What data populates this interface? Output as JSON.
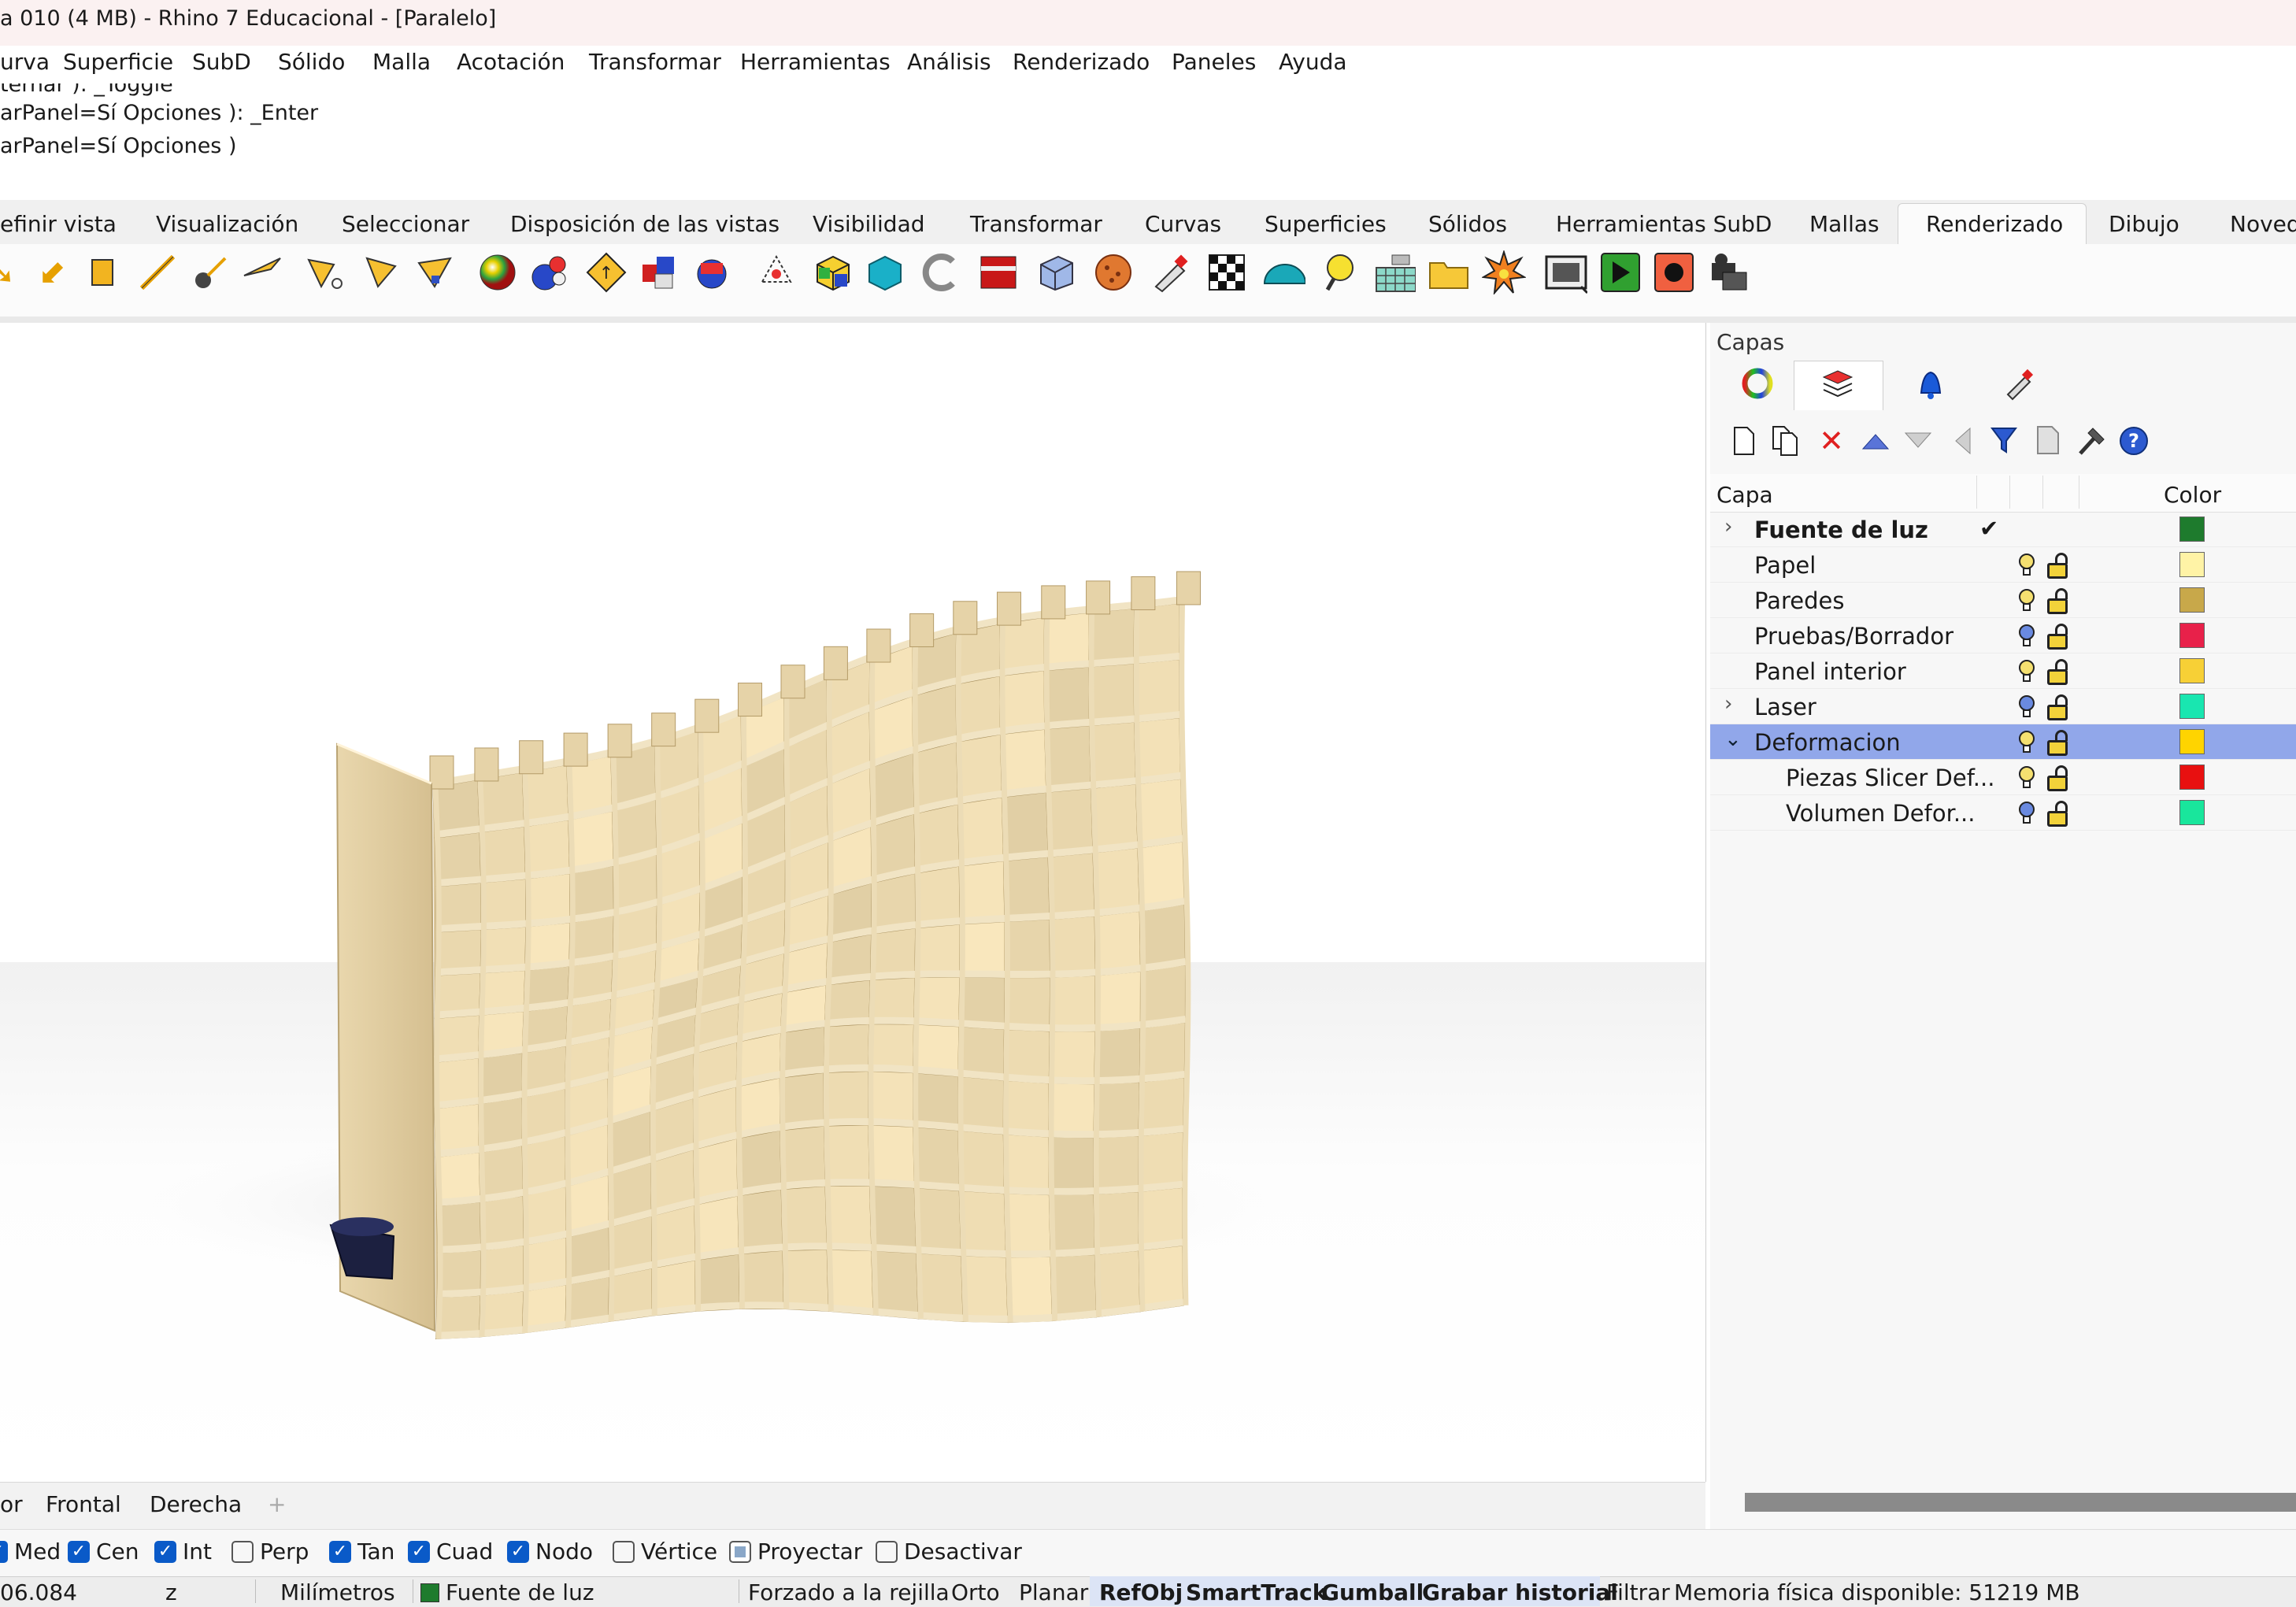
{
  "window": {
    "title": "a 010 (4 MB) - Rhino 7 Educacional - [Paralelo]"
  },
  "menu": [
    "urva",
    "Superficie",
    "SubD",
    "Sólido",
    "Malla",
    "Acotación",
    "Transformar",
    "Herramientas",
    "Análisis",
    "Renderizado",
    "Paneles",
    "Ayuda"
  ],
  "command_history": [
    "ternar ): _Toggle",
    "arPanel=Sí  Opciones ): _Enter",
    "arPanel=Sí  Opciones )"
  ],
  "toolbar_tabs": {
    "items": [
      "efinir vista",
      "Visualización",
      "Seleccionar",
      "Disposición de las vistas",
      "Visibilidad",
      "Transformar",
      "Curvas",
      "Superficies",
      "Sólidos",
      "Herramientas SubD",
      "Mallas",
      "Renderizado",
      "Dibujo",
      "Noved"
    ],
    "active": "Renderizado"
  },
  "toolbar_icons": [
    "directional-light-icon",
    "spotlight-icon",
    "rectangular-light-icon",
    "linear-light-icon",
    "point-light-icon",
    "light-icon",
    "edit-light-icon",
    "light-target-icon",
    "render-sphere-icon",
    "material-icon",
    "sun-icon",
    "decal-icon",
    "texture-map-icon",
    "environment-icon",
    "box-mapping-icon",
    "planar-mapping-icon",
    "cylindrical-mapping-icon",
    "spherical-mapping-icon",
    "uvw-mapping-icon",
    "texture-icon",
    "paint-icon",
    "checker-icon",
    "dome-icon",
    "lightbulb-icon",
    "ground-plane-icon",
    "folder-icon",
    "explode-icon",
    "render-window-icon",
    "render-icon",
    "record-icon",
    "camera-icon"
  ],
  "viewport_tabs": [
    "or",
    "Frontal",
    "Derecha",
    "+"
  ],
  "osnaps": [
    {
      "label": "Med",
      "state": "on"
    },
    {
      "label": "Cen",
      "state": "on"
    },
    {
      "label": "Int",
      "state": "on"
    },
    {
      "label": "Perp",
      "state": "off"
    },
    {
      "label": "Tan",
      "state": "on"
    },
    {
      "label": "Cuad",
      "state": "on"
    },
    {
      "label": "Nodo",
      "state": "on"
    },
    {
      "label": "Vértice",
      "state": "off"
    },
    {
      "label": "Proyectar",
      "state": "partial"
    },
    {
      "label": "Desactivar",
      "state": "off"
    }
  ],
  "status": {
    "coord": "06.084",
    "z": "z",
    "units": "Milímetros",
    "layer": "Fuente de luz",
    "layer_color": "#1e7b2d",
    "grid_snap": "Forzado a la rejilla",
    "ortho": "Orto",
    "planar": "Planar",
    "refobj": "RefObj",
    "smarttrack": "SmartTrack",
    "gumball": "Gumball",
    "history": "Grabar historial",
    "filter": "Filtrar",
    "memory": "Memoria física disponible: 51219 MB"
  },
  "panel": {
    "title": "Capas",
    "tabs": [
      "color-wheel-icon",
      "layers-icon",
      "notifications-icon",
      "display-icon"
    ],
    "icons": [
      "new-layer-icon",
      "new-sublayer-icon",
      "delete-icon",
      "move-up-icon",
      "move-down-icon",
      "move-left-icon",
      "filter-icon",
      "tools-icon",
      "settings-icon",
      "help-icon"
    ],
    "col_layer": "Capa",
    "col_color": "Color",
    "layers": [
      {
        "name": "Fuente de luz",
        "bold": true,
        "expander": "›",
        "current": "✔",
        "color": "#1e7b2d"
      },
      {
        "name": "Papel",
        "color": "#fff3a6"
      },
      {
        "name": "Paredes",
        "color": "#c8a84a"
      },
      {
        "name": "Pruebas/Borrador",
        "color": "#e8214a"
      },
      {
        "name": "Panel interior",
        "color": "#f7d036"
      },
      {
        "name": "Laser",
        "expander": "›",
        "color": "#19e6b0"
      },
      {
        "name": "Deformacion",
        "expander": "⌄",
        "selected": true,
        "color": "#ffd400"
      },
      {
        "name": "Piezas Slicer Def...",
        "indent": true,
        "color": "#e81010"
      },
      {
        "name": "Volumen Defor...",
        "indent": true,
        "color": "#19e69c"
      }
    ]
  }
}
